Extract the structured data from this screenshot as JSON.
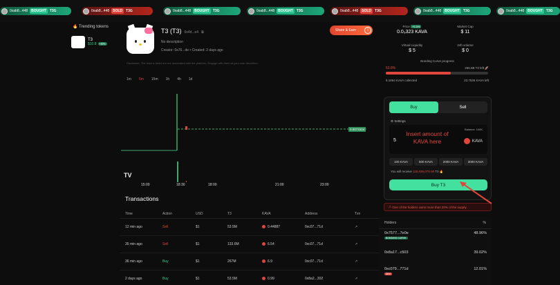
{
  "ticker": [
    {
      "addr": "0xab8...448",
      "action": "BOUGHT",
      "token": "T3G",
      "kind": "bought"
    },
    {
      "addr": "0xab8...448",
      "action": "SOLD",
      "token": "T3G",
      "kind": "sold"
    },
    {
      "addr": "0xab8...448",
      "action": "BOUGHT",
      "token": "T3G",
      "kind": "bought"
    },
    {
      "addr": "0xab8...448",
      "action": "BOUGHT",
      "token": "T3G",
      "kind": "bought"
    },
    {
      "addr": "0xab8...448",
      "action": "SOLD",
      "token": "T3G",
      "kind": "sold"
    },
    {
      "addr": "0xab8...448",
      "action": "BOUGHT",
      "token": "T3G",
      "kind": "bought"
    },
    {
      "addr": "0xab8...448",
      "action": "BOUGHT",
      "token": "T3G",
      "kind": "bought"
    }
  ],
  "trending": {
    "title": "Trending tokens",
    "item": {
      "name": "T3",
      "value": "$10.8",
      "change": "+6%"
    }
  },
  "token": {
    "name": "T3 (T3)",
    "address": "0x4d...e4",
    "description": "No description",
    "creator": "Creator: 0x76...de",
    "created": "Created: 2 days ago",
    "share_label": "Share & Earn",
    "info_icon": "i",
    "disclaimer": "Disclaimer: The tokens listed are not associated with the platform. Engage with them at your own discretion."
  },
  "timeframes": [
    "1m",
    "5m",
    "15m",
    "1h",
    "4h",
    "1d"
  ],
  "chart_data": {
    "type": "line",
    "x": [
      "15:00",
      "18:00",
      "21:00",
      "23:00"
    ],
    "x_labels": [
      "15:00",
      "18:30",
      "18:00",
      "21:00",
      "23:00"
    ],
    "price_label": "0.0071524",
    "values": [
      0.0068,
      0.0071524
    ],
    "grid": false
  },
  "transactions": {
    "title": "Transactions",
    "headers": [
      "Time",
      "Action",
      "USD",
      "T3",
      "KAVA",
      "Address",
      "Txn"
    ],
    "rows": [
      {
        "time": "12 min ago",
        "action": "Sell",
        "usd": "$1",
        "t3": "53.5M",
        "kava": "0.44887",
        "addr": "0xc07...71d"
      },
      {
        "time": "35 min ago",
        "action": "Sell",
        "usd": "$1",
        "t3": "133.6M",
        "kava": "6.54",
        "addr": "0xc07...71d"
      },
      {
        "time": "36 min ago",
        "action": "Buy",
        "usd": "$1",
        "t3": "267M",
        "kava": "6.9",
        "addr": "0xc07...71d"
      },
      {
        "time": "2 days ago",
        "action": "Buy",
        "usd": "$1",
        "t3": "53.5M",
        "kava": "0.99",
        "addr": "0x8a2...302"
      }
    ]
  },
  "stats": {
    "price": {
      "label": "Price",
      "change": "+6.0%",
      "value": "0.0₅323 KAVA"
    },
    "mcap": {
      "label": "Market Cap",
      "value": "$ 11"
    },
    "liquidity": {
      "label": "Virtual Liquidity",
      "value": "$ 5"
    },
    "volume": {
      "label": "24h volume",
      "value": "$ 0"
    }
  },
  "curve": {
    "title": "Bonding Curve progress",
    "progress_pct": "63.8%",
    "progress": 0.638,
    "tokens_left": "266.6B T3 left",
    "collected": "6.1654 KAVA collected",
    "kava_left": "23.7526 KAVA left"
  },
  "trade": {
    "buy_tab": "Buy",
    "sell_tab": "Sell",
    "settings": "Settings",
    "hint": "Insert amount of KAVA here",
    "balance": "Balance: 100K",
    "amount": "5",
    "currency": "KAVA",
    "presets": [
      "100 KAVA",
      "500 KAVA",
      "2000 KAVA",
      "3000 KAVA"
    ],
    "receive_label": "You will receive",
    "receive_value": "118,639,075.58",
    "receive_token": "T3",
    "buy_button": "Buy T3"
  },
  "warning": "One of the holders owns more than 20% of the supply.",
  "holders": {
    "title": "Holders",
    "pct_header": "%",
    "rows": [
      {
        "addr": "0x7577...7e0e",
        "tag": "BONDING CURVE",
        "pct": "48.96%"
      },
      {
        "addr": "0x8a17...c503",
        "tag": "",
        "pct": "39.02%"
      },
      {
        "addr": "0xc079...771d",
        "tag": "DEV",
        "pct": "12.01%"
      }
    ]
  }
}
